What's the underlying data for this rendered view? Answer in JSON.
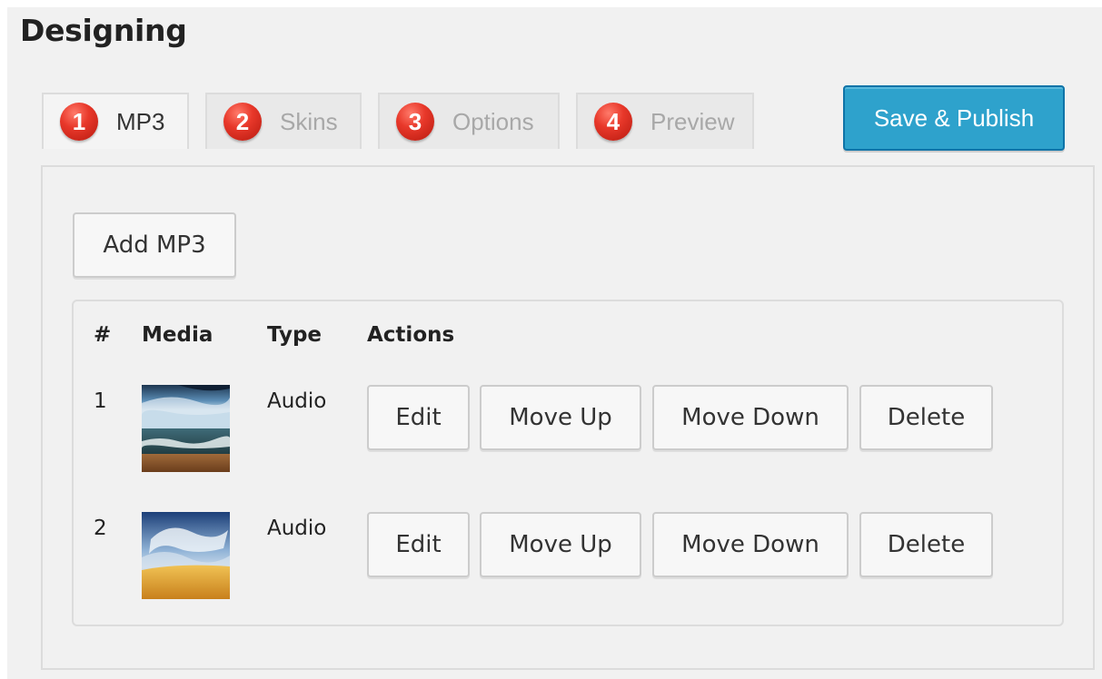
{
  "page": {
    "title": "Designing"
  },
  "tabs": [
    {
      "number": "1",
      "label": "MP3"
    },
    {
      "number": "2",
      "label": "Skins"
    },
    {
      "number": "3",
      "label": "Options"
    },
    {
      "number": "4",
      "label": "Preview"
    }
  ],
  "publish_label": "Save & Publish",
  "add_label": "Add MP3",
  "table": {
    "headers": [
      "#",
      "Media",
      "Type",
      "Actions"
    ],
    "rows": [
      {
        "num": "1",
        "type": "Audio",
        "thumbnail": "ocean-waves-thumbnail",
        "actions": [
          "Edit",
          "Move Up",
          "Move Down",
          "Delete"
        ]
      },
      {
        "num": "2",
        "type": "Audio",
        "thumbnail": "desert-sky-thumbnail",
        "actions": [
          "Edit",
          "Move Up",
          "Move Down",
          "Delete"
        ]
      }
    ]
  },
  "colors": {
    "background": "#f1f1f1",
    "publish_button": "#2ea2cc",
    "step_badge": "#e8382a"
  }
}
